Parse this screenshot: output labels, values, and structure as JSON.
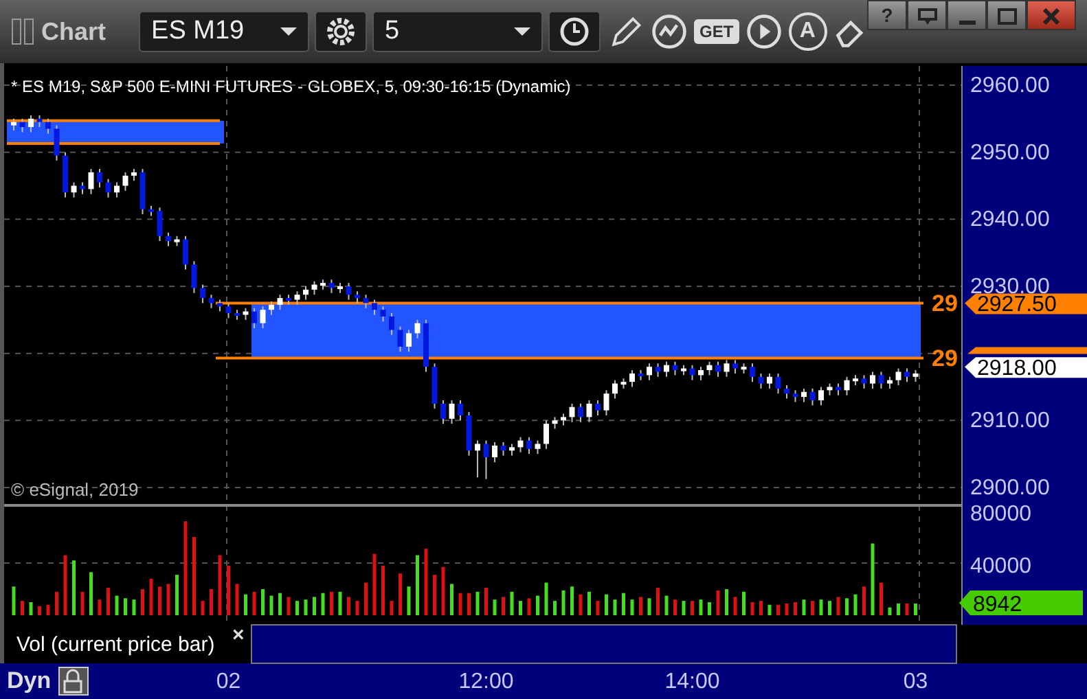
{
  "window": {
    "title": "Chart",
    "help": "?"
  },
  "toolbar": {
    "symbol": "ES M19",
    "interval": "5",
    "get_label": "GET",
    "text_tool": "A"
  },
  "chart": {
    "header": "* ES M19, S&P 500 E-MINI FUTURES - GLOBEX, 5, 09:30-16:15 (Dynamic)",
    "copyright": "© eSignal, 2019",
    "chart_data": {
      "type": "candlestick",
      "ohlc": [
        [
          2954,
          2955,
          2953.25,
          2954.5
        ],
        [
          2954.5,
          2955,
          2953,
          2953.75
        ],
        [
          2953.75,
          2955.5,
          2953,
          2955
        ],
        [
          2955,
          2955.5,
          2953.75,
          2954.5
        ],
        [
          2954.5,
          2955,
          2952.75,
          2953.5
        ],
        [
          2953.5,
          2954,
          2948.75,
          2949.5
        ],
        [
          2949.5,
          2950,
          2943.25,
          2944
        ],
        [
          2944,
          2945.5,
          2943.25,
          2945
        ],
        [
          2945,
          2945.5,
          2943.75,
          2944.5
        ],
        [
          2944.5,
          2947.5,
          2943.75,
          2947
        ],
        [
          2947,
          2947.5,
          2944.75,
          2945.5
        ],
        [
          2945.5,
          2946,
          2943.25,
          2944
        ],
        [
          2944,
          2945.5,
          2943.25,
          2945
        ],
        [
          2945,
          2947,
          2944.25,
          2946.5
        ],
        [
          2946.5,
          2947.5,
          2945.75,
          2947
        ],
        [
          2947,
          2947.5,
          2940.75,
          2941.5
        ],
        [
          2941.5,
          2942,
          2940.5,
          2941.25
        ],
        [
          2941.25,
          2941.75,
          2936.75,
          2937.5
        ],
        [
          2937.5,
          2938,
          2936,
          2936.75
        ],
        [
          2936.75,
          2937.5,
          2936,
          2937
        ],
        [
          2937,
          2937.5,
          2932.5,
          2933.25
        ],
        [
          2933.25,
          2933.75,
          2929,
          2929.75
        ],
        [
          2929.75,
          2930.25,
          2927.5,
          2928.25
        ],
        [
          2928.25,
          2928.75,
          2926.75,
          2927.5
        ],
        [
          2927.5,
          2928,
          2926.25,
          2927
        ],
        [
          2927,
          2927.5,
          2925.25,
          2926
        ],
        [
          2926,
          2926.5,
          2925,
          2925.75
        ],
        [
          2925.75,
          2926.75,
          2925,
          2926.25
        ],
        [
          2926.25,
          2926.75,
          2923.75,
          2924.5
        ],
        [
          2924.5,
          2927,
          2923.75,
          2926.5
        ],
        [
          2926.5,
          2927.75,
          2925.75,
          2927.25
        ],
        [
          2927.25,
          2928.75,
          2926.5,
          2928.25
        ],
        [
          2928.25,
          2928.75,
          2927.25,
          2928
        ],
        [
          2928,
          2929.25,
          2927.25,
          2928.75
        ],
        [
          2928.75,
          2930,
          2928,
          2929.5
        ],
        [
          2929.5,
          2930.75,
          2928.75,
          2930.25
        ],
        [
          2930.25,
          2931,
          2929.5,
          2930.5
        ],
        [
          2930.5,
          2931,
          2929,
          2929.75
        ],
        [
          2929.75,
          2930.5,
          2929,
          2930
        ],
        [
          2930,
          2930.5,
          2928,
          2928.75
        ],
        [
          2928.75,
          2929.25,
          2927.5,
          2928.25
        ],
        [
          2928.25,
          2928.75,
          2926.75,
          2927.5
        ],
        [
          2927.5,
          2928,
          2925.75,
          2926.5
        ],
        [
          2926.5,
          2927,
          2924.75,
          2925.5
        ],
        [
          2925.5,
          2926,
          2922.75,
          2923.5
        ],
        [
          2923.5,
          2924,
          2920.25,
          2921
        ],
        [
          2921,
          2923.5,
          2920.25,
          2923
        ],
        [
          2923,
          2925,
          2922.25,
          2924.5
        ],
        [
          2924.5,
          2925,
          2917.25,
          2918
        ],
        [
          2918,
          2918.5,
          2911.75,
          2912.5
        ],
        [
          2912.5,
          2913,
          2909.5,
          2910.25
        ],
        [
          2910.25,
          2913,
          2909.5,
          2912.5
        ],
        [
          2912.5,
          2913,
          2910,
          2910.75
        ],
        [
          2910.75,
          2911.25,
          2904.75,
          2905.5
        ],
        [
          2905.5,
          2907,
          2901.5,
          2906.5
        ],
        [
          2906.5,
          2907,
          2901.25,
          2904.5
        ],
        [
          2904.5,
          2906.75,
          2903.75,
          2906.25
        ],
        [
          2906.25,
          2906.75,
          2904.75,
          2905.5
        ],
        [
          2905.5,
          2906.5,
          2904.75,
          2906
        ],
        [
          2906,
          2907.5,
          2905.25,
          2907
        ],
        [
          2907,
          2907.5,
          2905,
          2905.75
        ],
        [
          2905.75,
          2907,
          2905,
          2906.5
        ],
        [
          2906.5,
          2910,
          2905.75,
          2909.5
        ],
        [
          2909.5,
          2910.5,
          2908.75,
          2910
        ],
        [
          2910,
          2911,
          2909.25,
          2910.5
        ],
        [
          2910.5,
          2912.5,
          2909.75,
          2912
        ],
        [
          2912,
          2912.5,
          2909.75,
          2910.5
        ],
        [
          2910.5,
          2913,
          2909.75,
          2912.5
        ],
        [
          2912.5,
          2913,
          2910.75,
          2911.5
        ],
        [
          2911.5,
          2914.5,
          2910.75,
          2914
        ],
        [
          2914,
          2916,
          2913.25,
          2915.5
        ],
        [
          2915.5,
          2916.25,
          2914.75,
          2915.75
        ],
        [
          2915.75,
          2917.5,
          2915,
          2917
        ],
        [
          2917,
          2917.5,
          2916,
          2916.75
        ],
        [
          2916.75,
          2918.5,
          2916,
          2918
        ],
        [
          2918,
          2918.5,
          2916.5,
          2917.25
        ],
        [
          2917.25,
          2918.75,
          2916.5,
          2918.25
        ],
        [
          2918.25,
          2918.75,
          2916.75,
          2917.5
        ],
        [
          2917.5,
          2918.25,
          2916.75,
          2917.75
        ],
        [
          2917.75,
          2918.25,
          2916,
          2916.75
        ],
        [
          2916.75,
          2918,
          2916,
          2917.5
        ],
        [
          2917.5,
          2918.75,
          2916.75,
          2918.25
        ],
        [
          2918.25,
          2918.75,
          2916.5,
          2917.25
        ],
        [
          2917.25,
          2919,
          2916.5,
          2918.5
        ],
        [
          2918.5,
          2919,
          2917,
          2917.75
        ],
        [
          2917.75,
          2918.5,
          2917,
          2918
        ],
        [
          2918,
          2918.5,
          2915.75,
          2916.5
        ],
        [
          2916.5,
          2917,
          2914.75,
          2915.5
        ],
        [
          2915.5,
          2917,
          2914.75,
          2916.5
        ],
        [
          2916.5,
          2917,
          2914,
          2914.75
        ],
        [
          2914.75,
          2915.25,
          2913.25,
          2914
        ],
        [
          2914,
          2914.5,
          2912.75,
          2913.5
        ],
        [
          2913.5,
          2914.75,
          2912.75,
          2914.25
        ],
        [
          2914.25,
          2914.75,
          2912.25,
          2913
        ],
        [
          2913,
          2915,
          2912.25,
          2914.5
        ],
        [
          2914.5,
          2915.5,
          2913.75,
          2915
        ],
        [
          2915,
          2915.5,
          2913.75,
          2914.5
        ],
        [
          2914.5,
          2916.5,
          2913.75,
          2916
        ],
        [
          2916,
          2916.75,
          2915.25,
          2916.25
        ],
        [
          2916.25,
          2916.75,
          2914.75,
          2915.5
        ],
        [
          2915.5,
          2917.25,
          2914.75,
          2916.75
        ],
        [
          2916.75,
          2917.25,
          2914.75,
          2915.5
        ],
        [
          2915.5,
          2916.5,
          2914.75,
          2916
        ],
        [
          2916,
          2917.75,
          2915.25,
          2917.25
        ],
        [
          2917.25,
          2917.75,
          2915.75,
          2916.5
        ],
        [
          2916.5,
          2917.5,
          2915.75,
          2917
        ]
      ],
      "ylim": [
        2897.33,
        2962.87
      ],
      "yticks": [
        {
          "value": 2960,
          "label": "2960.00"
        },
        {
          "value": 2950,
          "label": "2950.00"
        },
        {
          "value": 2940,
          "label": "2940.00"
        },
        {
          "value": 2930,
          "label": "2930.00"
        },
        {
          "value": 2910,
          "label": "2910.00"
        },
        {
          "value": 2900,
          "label": "2900.00"
        }
      ]
    },
    "zone_labels": [
      "29",
      "29"
    ],
    "price_tags": [
      {
        "text": "2927.50",
        "color": "#ff8000"
      },
      {
        "text": "2918.00",
        "color": "#ffffff"
      }
    ]
  },
  "volume": {
    "chart_data": {
      "type": "bar",
      "ylim": [
        0,
        80000
      ],
      "values": [
        22000,
        11000,
        10000,
        7000,
        8000,
        18000,
        46000,
        42000,
        18000,
        33000,
        12000,
        21000,
        15000,
        13000,
        12000,
        20000,
        28000,
        22000,
        24000,
        31000,
        72000,
        60000,
        11000,
        20000,
        46000,
        38000,
        24000,
        16000,
        18000,
        20000,
        15000,
        17000,
        14000,
        11000,
        12000,
        14000,
        17000,
        18000,
        18000,
        14000,
        11000,
        25000,
        47000,
        38000,
        11000,
        32000,
        22000,
        46000,
        51000,
        31000,
        37000,
        24000,
        17000,
        17000,
        18000,
        21000,
        12000,
        14000,
        18000,
        11000,
        13000,
        15000,
        25000,
        11000,
        19000,
        22000,
        16000,
        18000,
        11000,
        16000,
        12000,
        17000,
        12000,
        14000,
        13000,
        21000,
        15000,
        12000,
        11000,
        11000,
        12000,
        10000,
        19000,
        20000,
        14000,
        18000,
        10000,
        11000,
        8000,
        8000,
        9000,
        10000,
        12000,
        11000,
        12000,
        11000,
        14000,
        13000,
        16000,
        22000,
        55000,
        25000,
        6000,
        9000,
        9000,
        8942
      ],
      "yticks": [
        {
          "value": 80000,
          "label": "80000"
        },
        {
          "value": 40000,
          "label": "40000"
        }
      ]
    },
    "current": "8942",
    "legend": "Vol (current price bar)",
    "close": "×"
  },
  "time_axis": {
    "mode": "Dyn",
    "labels": [
      "02",
      "12:00",
      "14:00",
      "03"
    ]
  }
}
